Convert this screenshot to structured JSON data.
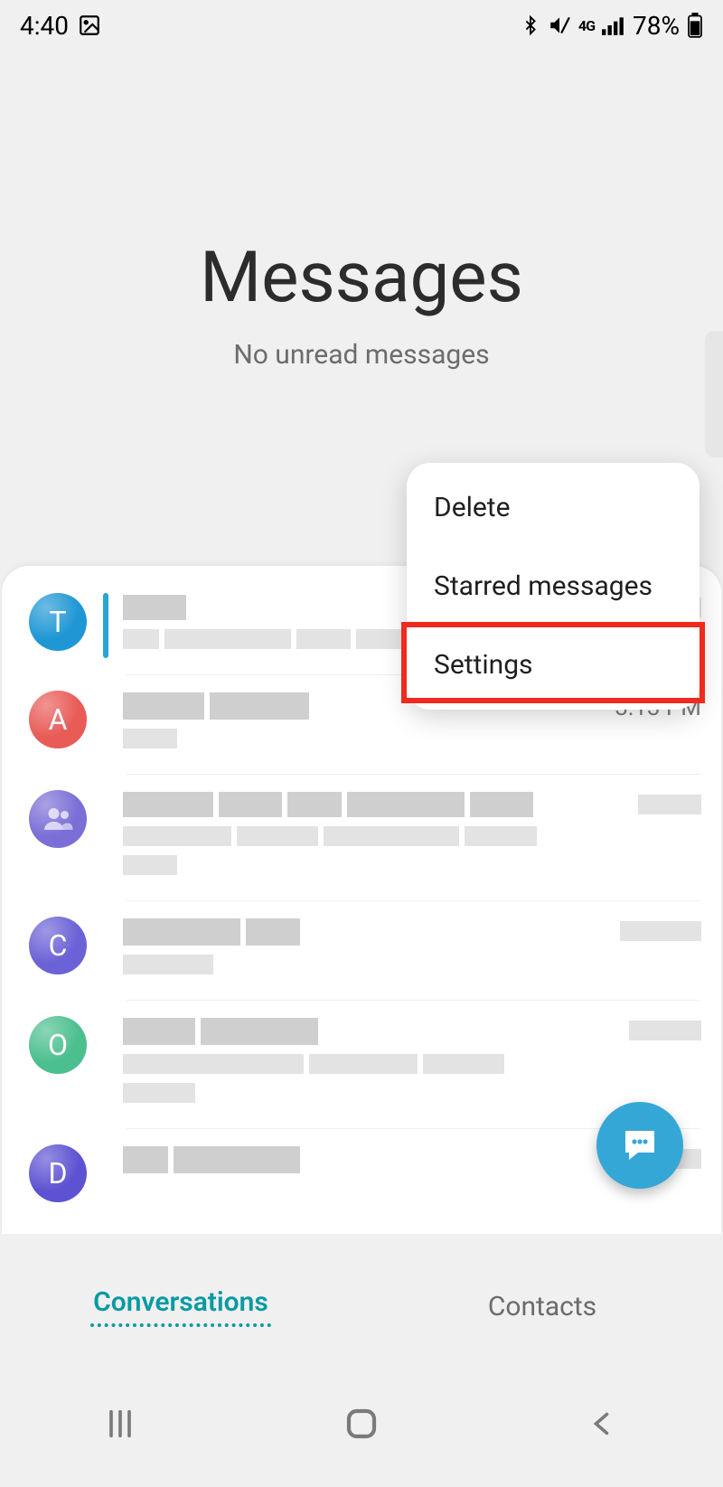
{
  "status": {
    "time": "4:40",
    "battery": "78%",
    "network_label": "4G"
  },
  "hero": {
    "title": "Messages",
    "subtitle": "No unread messages"
  },
  "menu": {
    "items": [
      "Delete",
      "Starred messages",
      "Settings"
    ],
    "highlighted_index": 2
  },
  "conversations": [
    {
      "avatar_letter": "T",
      "avatar_color": "#1f97d4",
      "time": "",
      "accent_bar": true
    },
    {
      "avatar_letter": "A",
      "avatar_color": "#e85b57",
      "time": "3:13 PM"
    },
    {
      "avatar_letter": "",
      "avatar_icon": "group",
      "avatar_color": "#7b6ed6",
      "time": ""
    },
    {
      "avatar_letter": "C",
      "avatar_color": "#6a62d6",
      "time": ""
    },
    {
      "avatar_letter": "O",
      "avatar_color": "#4cbf8e",
      "time": ""
    },
    {
      "avatar_letter": "D",
      "avatar_color": "#5d53d2",
      "time": ""
    }
  ],
  "tabs": {
    "active": "Conversations",
    "items": [
      "Conversations",
      "Contacts"
    ]
  }
}
